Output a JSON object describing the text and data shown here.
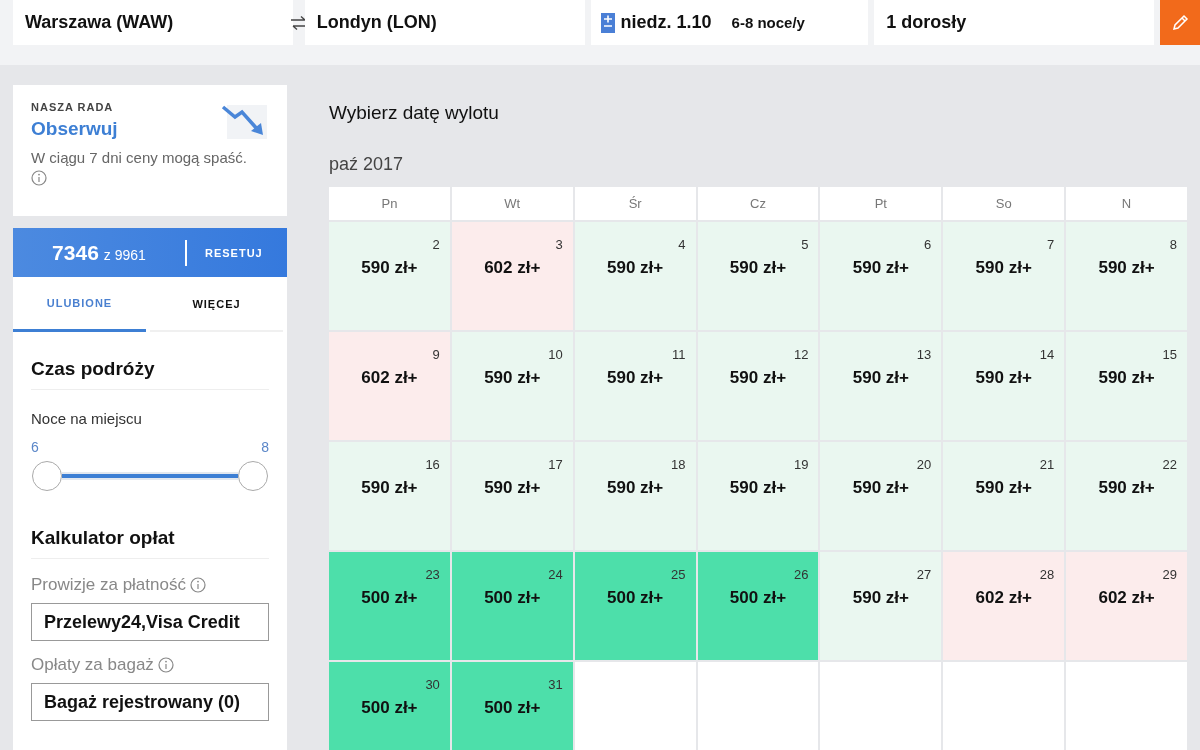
{
  "search_bar": {
    "origin": "Warszawa (WAW)",
    "destination": "Londyn (LON)",
    "date": "niedz. 1.10",
    "nights": "6-8 noce/y",
    "passengers": "1 dorosły"
  },
  "advice": {
    "label": "NASZA RADA",
    "title": "Obserwuj",
    "text": "W ciągu 7 dni ceny mogą spaść."
  },
  "results": {
    "count": "7346",
    "total": "z 9961",
    "reset": "RESETUJ"
  },
  "tabs": [
    {
      "label": "ULUBIONE",
      "selected": true
    },
    {
      "label": "WIĘCEJ",
      "selected": false
    }
  ],
  "travel_time": {
    "title": "Czas podróży",
    "label": "Noce na miejscu",
    "min": "6",
    "max": "8",
    "slider": {
      "level": 1
    }
  },
  "fee_calculator": {
    "title": "Kalkulator opłat",
    "fields": [
      {
        "label": "Prowizje za płatność",
        "value": "Przelewy24,Visa Credit"
      },
      {
        "label": "Opłaty za bagaż",
        "value": "Bagaż rejestrowany (0)"
      }
    ]
  },
  "calendar": {
    "title": "Wybierz datę wylotu",
    "month": "paź 2017",
    "weekdays": [
      "Pn",
      "Wt",
      "Śr",
      "Cz",
      "Pt",
      "So",
      "N"
    ],
    "days": [
      {
        "day": "2",
        "price": "590 zł+",
        "kind": "mid"
      },
      {
        "day": "3",
        "price": "602 zł+",
        "kind": "high"
      },
      {
        "day": "4",
        "price": "590 zł+",
        "kind": "mid"
      },
      {
        "day": "5",
        "price": "590 zł+",
        "kind": "mid"
      },
      {
        "day": "6",
        "price": "590 zł+",
        "kind": "mid"
      },
      {
        "day": "7",
        "price": "590 zł+",
        "kind": "mid"
      },
      {
        "day": "8",
        "price": "590 zł+",
        "kind": "mid"
      },
      {
        "day": "9",
        "price": "602 zł+",
        "kind": "high"
      },
      {
        "day": "10",
        "price": "590 zł+",
        "kind": "mid"
      },
      {
        "day": "11",
        "price": "590 zł+",
        "kind": "mid"
      },
      {
        "day": "12",
        "price": "590 zł+",
        "kind": "mid"
      },
      {
        "day": "13",
        "price": "590 zł+",
        "kind": "mid"
      },
      {
        "day": "14",
        "price": "590 zł+",
        "kind": "mid"
      },
      {
        "day": "15",
        "price": "590 zł+",
        "kind": "mid"
      },
      {
        "day": "16",
        "price": "590 zł+",
        "kind": "mid"
      },
      {
        "day": "17",
        "price": "590 zł+",
        "kind": "mid"
      },
      {
        "day": "18",
        "price": "590 zł+",
        "kind": "mid"
      },
      {
        "day": "19",
        "price": "590 zł+",
        "kind": "mid"
      },
      {
        "day": "20",
        "price": "590 zł+",
        "kind": "mid"
      },
      {
        "day": "21",
        "price": "590 zł+",
        "kind": "mid"
      },
      {
        "day": "22",
        "price": "590 zł+",
        "kind": "mid"
      },
      {
        "day": "23",
        "price": "500 zł+",
        "kind": "low"
      },
      {
        "day": "24",
        "price": "500 zł+",
        "kind": "low"
      },
      {
        "day": "25",
        "price": "500 zł+",
        "kind": "low"
      },
      {
        "day": "26",
        "price": "500 zł+",
        "kind": "low"
      },
      {
        "day": "27",
        "price": "590 zł+",
        "kind": "mid"
      },
      {
        "day": "28",
        "price": "602 zł+",
        "kind": "high"
      },
      {
        "day": "29",
        "price": "602 zł+",
        "kind": "high"
      },
      {
        "day": "30",
        "price": "500 zł+",
        "kind": "low"
      },
      {
        "day": "31",
        "price": "500 zł+",
        "kind": "low"
      },
      {
        "kind": "empty"
      },
      {
        "kind": "empty"
      },
      {
        "kind": "empty"
      },
      {
        "kind": "empty"
      },
      {
        "kind": "empty"
      }
    ]
  }
}
